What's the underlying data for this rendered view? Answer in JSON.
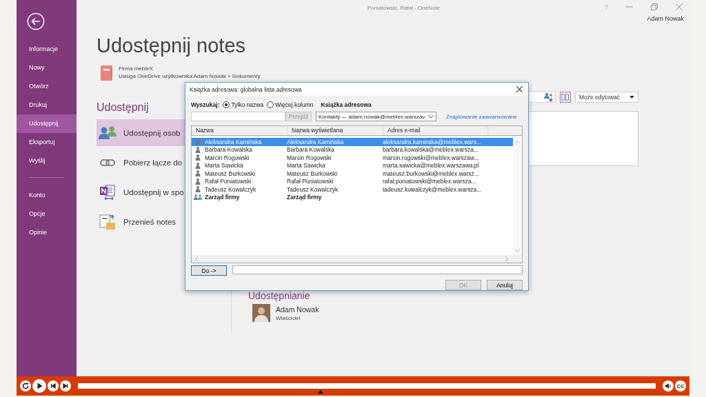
{
  "window": {
    "title": "Poniatowski, Rafał - OneNote",
    "help": "?",
    "user": "Adam Nowak"
  },
  "sidebar": {
    "items": [
      {
        "label": "Informacje",
        "selected": false
      },
      {
        "label": "Nowy",
        "selected": false
      },
      {
        "label": "Otwórz",
        "selected": false
      },
      {
        "label": "Drukuj",
        "selected": false
      },
      {
        "label": "Udostępnij",
        "selected": true
      },
      {
        "label": "Eksportuj",
        "selected": false
      },
      {
        "label": "Wyślij",
        "selected": false
      }
    ],
    "bottom_items": [
      {
        "label": "Konto",
        "selected": false
      },
      {
        "label": "Opcje",
        "selected": false
      },
      {
        "label": "Opinie",
        "selected": false
      }
    ]
  },
  "page": {
    "title": "Udostępnij notes",
    "notebook": {
      "name": "Firma mebleX",
      "location": "Usługa OneDrive użytkownika Adam Nowak » Dokumenty"
    },
    "section_title": "Udostępnij",
    "options": [
      {
        "kind": "people",
        "label": "Udostępnij osob",
        "selected": true
      },
      {
        "kind": "link",
        "label": "Pobierz łącze do",
        "selected": false
      },
      {
        "kind": "meeting",
        "label": "Udostępnij w spo",
        "selected": false
      },
      {
        "kind": "move",
        "label": "Przenieś notes",
        "selected": false
      }
    ]
  },
  "share_panel": {
    "permission": "Może edytować",
    "sharing_title": "Udostępnianie",
    "owner": {
      "name": "Adam Nowak",
      "role": "Właściciel"
    }
  },
  "dialog": {
    "title": "Książka adresowa: globalna lista adresowa",
    "search_label": "Wyszukaj:",
    "search_modes": [
      {
        "label": "Tylko nazwa",
        "selected": true
      },
      {
        "label": "Więcej kolumn",
        "selected": false
      }
    ],
    "go_button": {
      "label": "Przejdź",
      "disabled": true
    },
    "book_label": "Książka adresowa",
    "book": "Kontakty — adam.nowak@meblex.warszav",
    "advanced_link": "Znajdowanie zaawansowane",
    "columns": [
      "Nazwa",
      "Nazwa wyświetlana",
      "Adres e-mail"
    ],
    "rows": [
      {
        "kind": "person",
        "name": "Aleksandra Kamińska",
        "display": "Aleksandra Kamińska",
        "email": "aleksandra.kaminska@meblex.wars...",
        "selected": true
      },
      {
        "kind": "person",
        "name": "Barbara Kowalska",
        "display": "Barbara Kowalska",
        "email": "barbara.kowalska@meblex.warsza...",
        "selected": false
      },
      {
        "kind": "person",
        "name": "Marcin Rogowski",
        "display": "Marcin Rogowski",
        "email": "marcin.rogowski@meblex.warszaw...",
        "selected": false
      },
      {
        "kind": "person",
        "name": "Marta Sawicka",
        "display": "Marta Sawicka",
        "email": "marta.sawicka@meblex.warszawa.pl",
        "selected": false
      },
      {
        "kind": "person",
        "name": "Mateusz Burkowski",
        "display": "Mateusz Burkowski",
        "email": "mateusz.burkowski@meblex.warsz...",
        "selected": false
      },
      {
        "kind": "person",
        "name": "Rafał Poniatowski",
        "display": "Rafał Poniatowski",
        "email": "rafal.poniatowski@meblex.warsza...",
        "selected": false
      },
      {
        "kind": "person",
        "name": "Tadeusz Kowalczyk",
        "display": "Tadeusz Kowalczyk",
        "email": "tadeusz.kowalczyk@meblex.warsza...",
        "selected": false
      },
      {
        "kind": "group",
        "name": "Zarząd firmy",
        "display": "Zarząd firmy",
        "selected": false
      }
    ],
    "to_button": "Do ->",
    "ok_button": {
      "label": "OK",
      "disabled": true
    },
    "cancel_button": {
      "label": "Anuluj",
      "disabled": false
    }
  },
  "player": {
    "level": 0.42,
    "captions": "CC"
  }
}
